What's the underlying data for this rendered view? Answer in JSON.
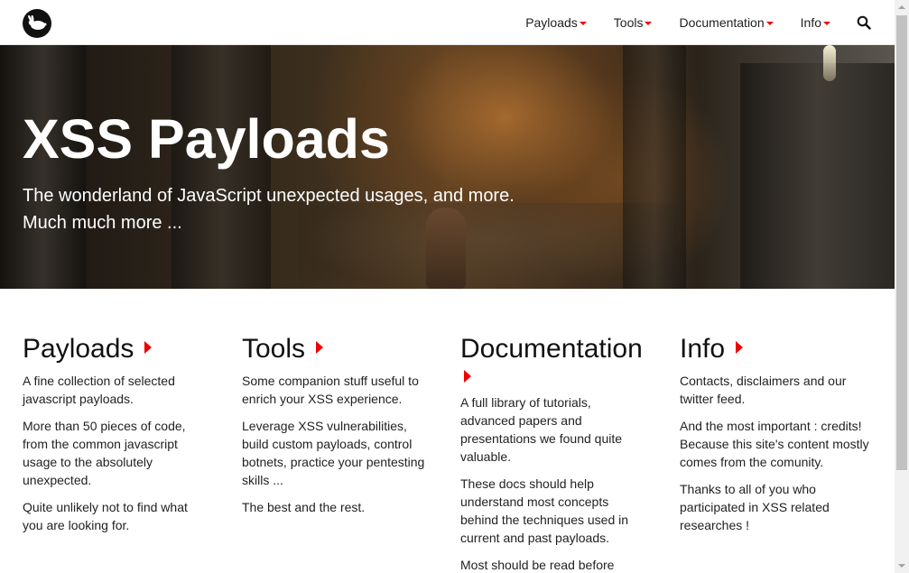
{
  "nav": {
    "logo_icon": "rabbit-icon",
    "items": [
      {
        "label": "Payloads"
      },
      {
        "label": "Tools"
      },
      {
        "label": "Documentation"
      },
      {
        "label": "Info"
      }
    ],
    "search_icon": "search-icon",
    "caret_color": "#e00000"
  },
  "hero": {
    "title": "XSS Payloads",
    "subtitle_line1": "The wonderland of JavaScript unexpected usages, and more.",
    "subtitle_line2": "Much much more ..."
  },
  "columns": [
    {
      "title": "Payloads",
      "paragraphs": [
        "A fine collection of selected javascript payloads.",
        "More than 50 pieces of code, from the common javascript usage to the absolutely unexpected.",
        "Quite unlikely not to find what you are looking for."
      ]
    },
    {
      "title": "Tools",
      "paragraphs": [
        "Some companion stuff useful to enrich your XSS experience.",
        "Leverage XSS vulnerabilities, build custom payloads, control botnets, practice your pentesting skills ...",
        "The best and the rest."
      ]
    },
    {
      "title": "Documentation",
      "paragraphs": [
        "A full library of tutorials, advanced papers and presentations we found quite valuable.",
        "These docs should help understand most concepts behind the techniques used in current and past payloads.",
        "Most should be read before"
      ]
    },
    {
      "title": "Info",
      "paragraphs": [
        "Contacts, disclaimers and our twitter feed.",
        "And the most important : credits! Because this site's content mostly comes from the comunity.",
        "Thanks to all of you who participated in XSS related researches !"
      ]
    }
  ],
  "accent_color": "#e00000"
}
